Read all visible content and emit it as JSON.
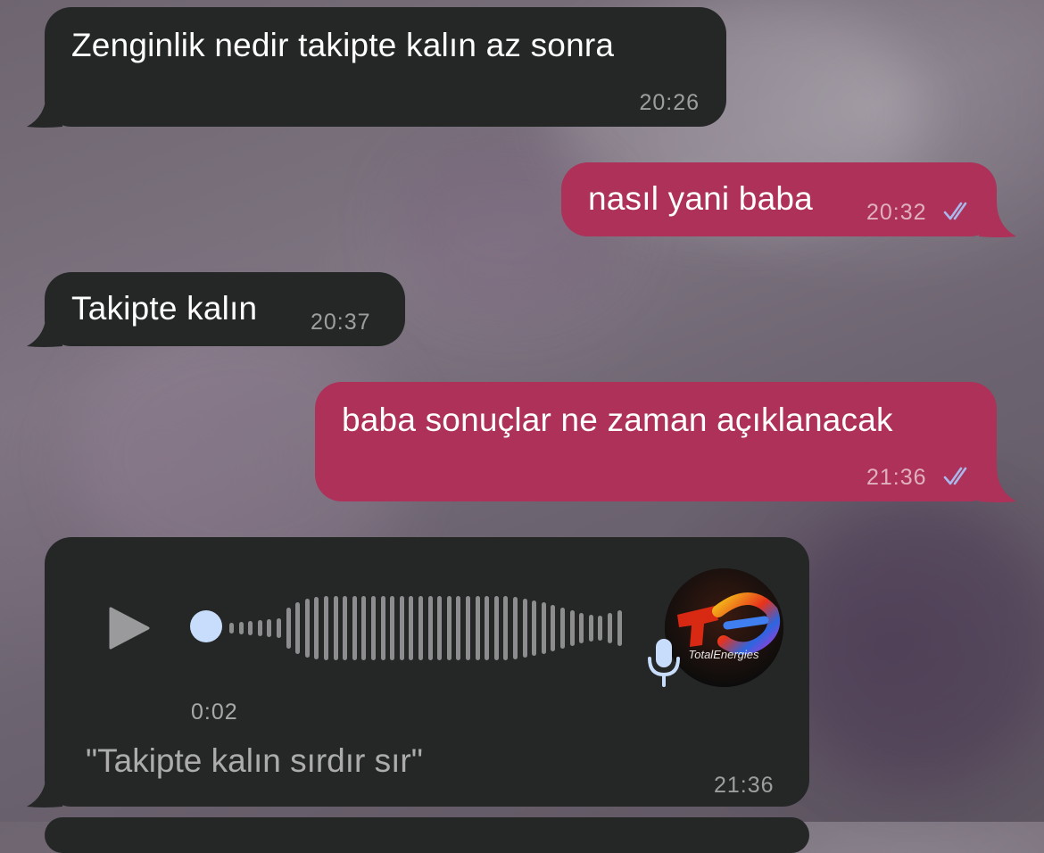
{
  "messages": [
    {
      "text": "Zenginlik nedir takipte kalın az sonra",
      "time": "20:26",
      "direction": "incoming"
    },
    {
      "text": "nasıl yani baba",
      "time": "20:32",
      "direction": "outgoing",
      "status": "read"
    },
    {
      "text": "Takipte kalın",
      "time": "20:37",
      "direction": "incoming"
    },
    {
      "text": "baba sonuçlar ne zaman açıklanacak",
      "time": "21:36",
      "direction": "outgoing",
      "status": "read"
    }
  ],
  "voice_message": {
    "duration": "0:02",
    "transcript": "\"Takipte kalın sırdır sır\"",
    "time": "21:36",
    "progress": 0.0,
    "avatar_logo_text": "TotalEnergies",
    "icons": [
      "play-icon",
      "microphone-icon"
    ]
  },
  "colors": {
    "incoming_bubble": "#252727",
    "outgoing_bubble": "#ad3158",
    "read_checks": "#a9b8ec",
    "playhead": "#c8ddfb"
  }
}
